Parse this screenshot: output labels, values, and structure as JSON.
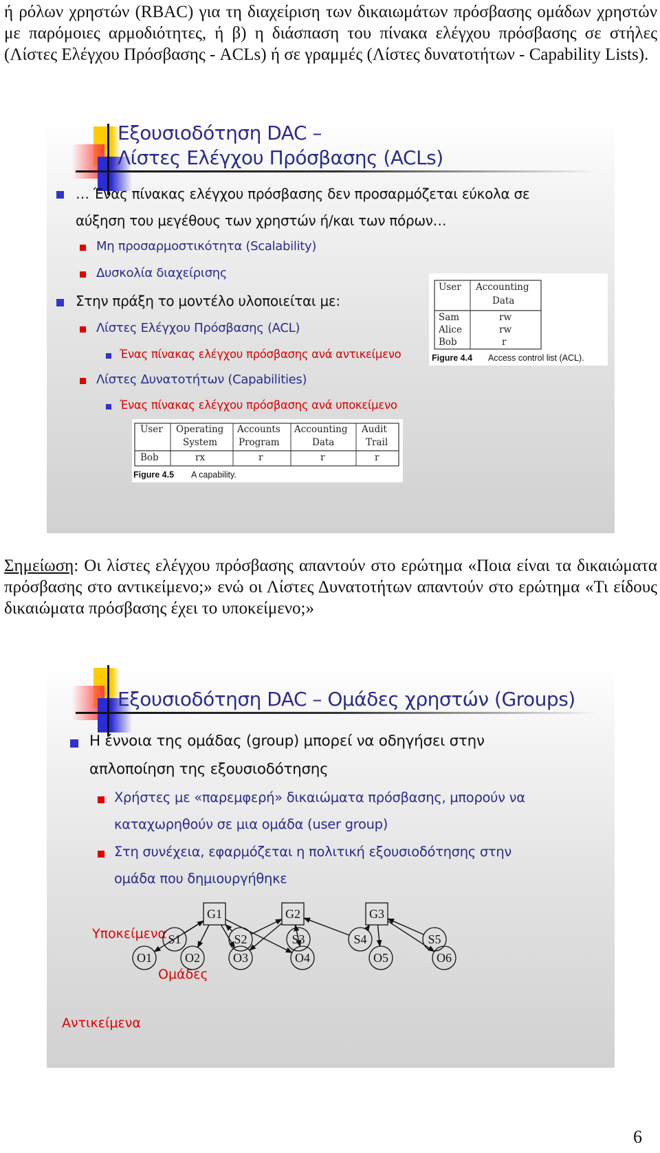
{
  "intro_paragraph": "ή ρόλων χρηστών (RBAC) για τη διαχείριση των δικαιωμάτων πρόσβασης ομάδων χρηστών με παρόμοιες αρμοδιότητες, ή β) η διάσπαση του πίνακα ελέγχου πρόσβασης σε στήλες (Λίστες Ελέγχου Πρόσβασης - ACLs) ή σε γραμμές (Λίστες δυνατοτήτων - Capability Lists).",
  "slide1": {
    "title_line1": "Εξουσιοδότηση DAC –",
    "title_line2": "Λίστες Ελέγχου Πρόσβασης (ACLs)",
    "bullets": {
      "b1_line1": "… Ένας πίνακας ελέγχου πρόσβασης δεν προσαρμόζεται εύκολα σε",
      "b1_line2": "αύξηση του μεγέθους των χρηστών ή/και των πόρων…",
      "b1_sub1": "Μη προσαρμοστικότητα (Scalability)",
      "b1_sub2": "Δυσκολία διαχείρισης",
      "b2": "Στην πράξη το μοντέλο υλοποιείται με:",
      "b2_sub1": "Λίστες Ελέγχου Πρόσβασης (ACL)",
      "b2_sub1_sub": "Ένας πίνακας ελέγχου πρόσβασης ανά αντικείμενο",
      "b2_sub2": "Λίστες Δυνατοτήτων (Capabilities)",
      "b2_sub2_sub": "Ένας πίνακας ελέγχου πρόσβασης ανά υποκείμενο"
    },
    "figure44": {
      "headers": [
        "User",
        "Accounting",
        "Data"
      ],
      "rows": [
        [
          "Sam",
          "rw"
        ],
        [
          "Alice",
          "rw"
        ],
        [
          "Bob",
          "r"
        ]
      ],
      "caption_label": "Figure 4.4",
      "caption_text": "Access control list (ACL)."
    },
    "figure45": {
      "headers_line1": [
        "User",
        "Operating",
        "Accounts",
        "Accounting",
        "Audit"
      ],
      "headers_line2": [
        "",
        "System",
        "Program",
        "Data",
        "Trail"
      ],
      "row": [
        "Bob",
        "rx",
        "r",
        "r",
        "r"
      ],
      "caption_label": "Figure 4.5",
      "caption_text": "A capability."
    }
  },
  "note": {
    "label": "Σημείωση",
    "text": ": Οι λίστες ελέγχου πρόσβασης απαντούν στο ερώτημα «Ποια είναι τα δικαιώματα πρόσβασης στο αντικείμενο;» ενώ οι Λίστες Δυνατοτήτων απαντούν στο ερώτημα «Τι είδους δικαιώματα πρόσβασης έχει το υποκείμενο;»"
  },
  "slide2": {
    "title": "Εξουσιοδότηση DAC – Ομάδες χρηστών (Groups)",
    "b1_line1": "Η έννοια της ομάδας (group) μπορεί να οδηγήσει στην",
    "b1_line2": "απλοποίηση της εξουσιοδότησης",
    "sub1_line1": "Χρήστες με «παρεμφερή» δικαιώματα πρόσβασης, μπορούν να",
    "sub1_line2": "καταχωρηθούν σε μια ομάδα (user group)",
    "sub2_line1": "Στη συνέχεια, εφαρμόζεται η πολιτική εξουσιοδότησης στην",
    "sub2_line2": "ομάδα που δημιουργήθηκε",
    "diagram": {
      "label_subjects": "Υποκείμενα",
      "label_groups": "Ομάδες",
      "label_objects": "Αντικείμενα",
      "subjects": [
        "S1",
        "S2",
        "S3",
        "S4",
        "S5"
      ],
      "groups": [
        "G1",
        "G2",
        "G3"
      ],
      "objects": [
        "O1",
        "O2",
        "O3",
        "O4",
        "O5",
        "O6"
      ],
      "edges": [
        [
          "S1",
          "G1"
        ],
        [
          "S2",
          "G1"
        ],
        [
          "S2",
          "G2"
        ],
        [
          "S3",
          "G2"
        ],
        [
          "S4",
          "G2"
        ],
        [
          "S4",
          "G3"
        ],
        [
          "S5",
          "G3"
        ],
        [
          "G1",
          "O1"
        ],
        [
          "G1",
          "O2"
        ],
        [
          "G1",
          "O3"
        ],
        [
          "G1",
          "O4"
        ],
        [
          "G2",
          "O3"
        ],
        [
          "G2",
          "O4"
        ],
        [
          "G3",
          "O5"
        ],
        [
          "G3",
          "O6"
        ]
      ]
    }
  },
  "page_number": "6"
}
